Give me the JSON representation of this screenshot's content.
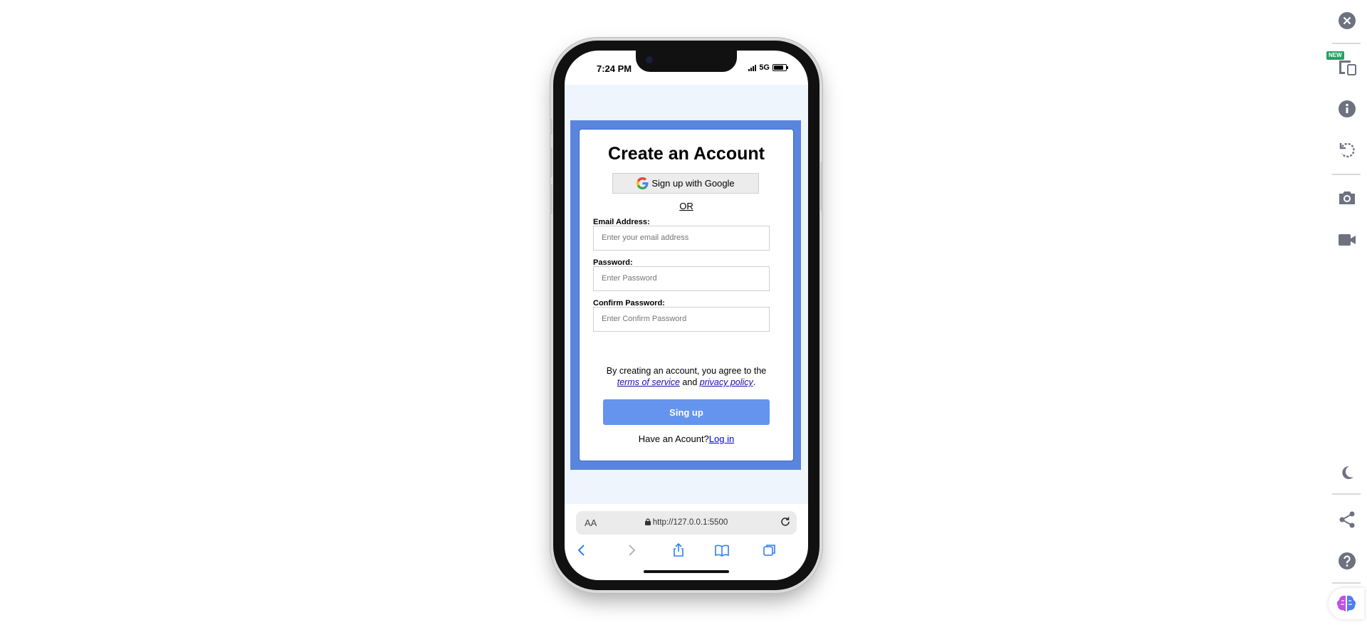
{
  "status_bar": {
    "time": "7:24 PM",
    "network": "5G"
  },
  "form": {
    "title": "Create an Account",
    "google_button": "Sign up with Google",
    "or_text": "OR",
    "email_label": "Email Address:",
    "email_placeholder": "Enter your email address",
    "password_label": "Password:",
    "password_placeholder": "Enter Password",
    "confirm_label": "Confirm Password:",
    "confirm_placeholder": "Enter Confirm Password",
    "terms_prefix": "By creating an account, you agree to the",
    "terms_link": "terms of service",
    "terms_and": "and",
    "privacy_link": "privacy policy",
    "terms_suffix": ".",
    "signup_button": "Sing up",
    "have_account_text": "Have an Acount?",
    "login_link": "Log in"
  },
  "browser": {
    "text_size_label": "AA",
    "url": "http://127.0.0.1:5500"
  },
  "rail": {
    "new_badge": "NEW"
  },
  "colors": {
    "frame_blue": "#5a85dc",
    "button_blue": "#6494ed",
    "page_bg": "#eef5fd",
    "badge_green": "#1fa463"
  }
}
